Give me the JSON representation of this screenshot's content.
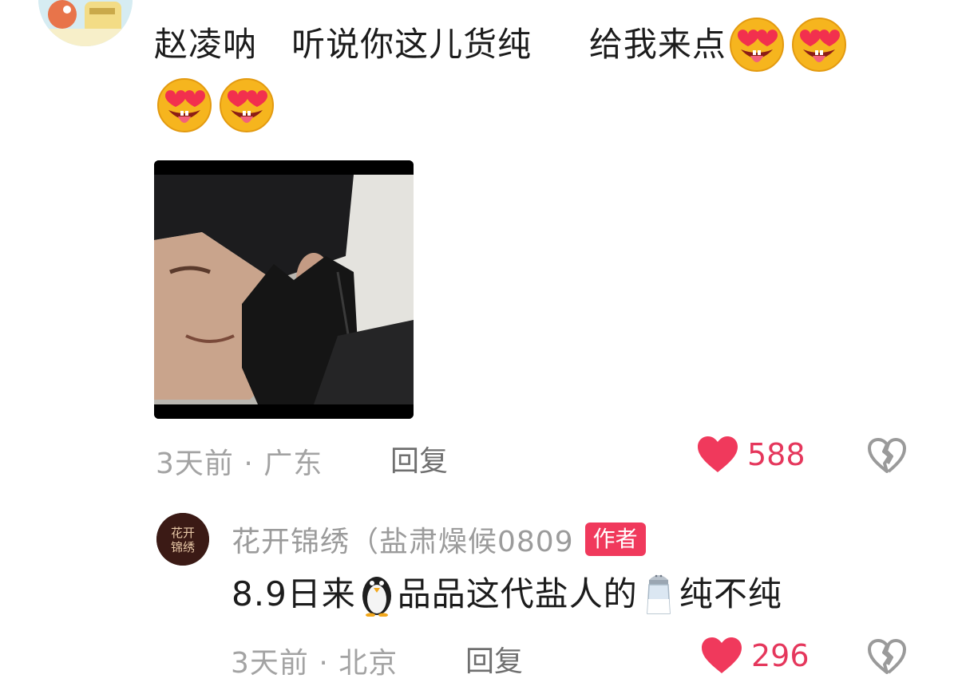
{
  "comment": {
    "text_line1_a": "赵凌呐",
    "text_line1_b": "听说你这儿货纯",
    "text_line1_c": "给我来点",
    "emojis": [
      "heart-eyes-tongue-emoji",
      "heart-eyes-tongue-emoji",
      "heart-eyes-tongue-emoji",
      "heart-eyes-tongue-emoji"
    ],
    "meta": "3天前 · 广东",
    "reply_label": "回复",
    "like_count": "588"
  },
  "reply": {
    "author": "花开锦绣（盐肃燥候0809",
    "badge": "作者",
    "text_a": "8.9日来",
    "text_b": "品品这代盐人的",
    "text_c": "纯不纯",
    "inline_emojis": [
      "penguin-emoji",
      "salt-shaker-emoji"
    ],
    "meta": "3天前 · 北京",
    "reply_label": "回复",
    "like_count": "296"
  },
  "colors": {
    "like": "#f0395c",
    "like_count": "#e5375c",
    "meta": "#a3a3a3",
    "badge": "#f0395c"
  }
}
